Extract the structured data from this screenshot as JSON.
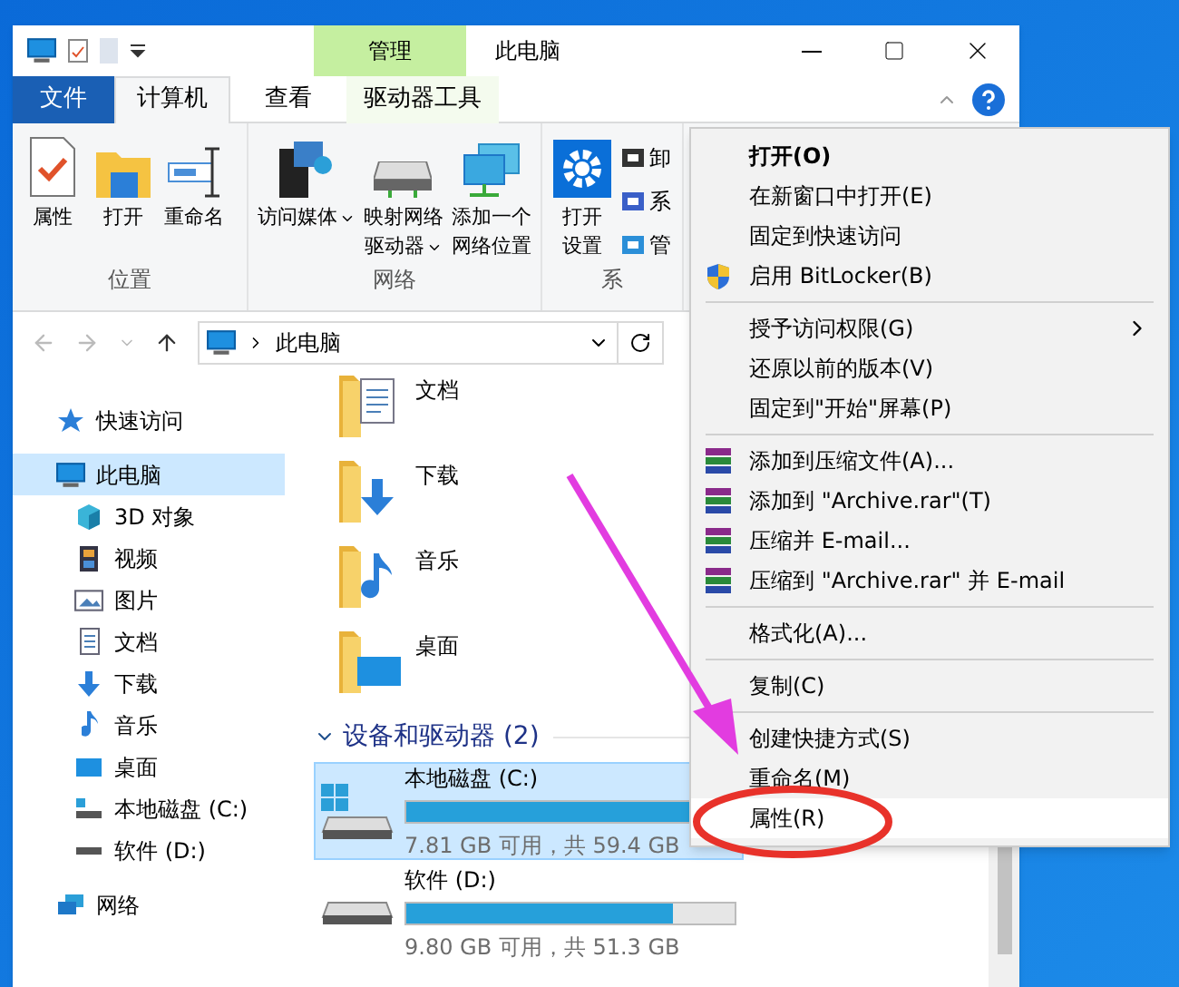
{
  "window": {
    "title": "此电脑",
    "context_header": "管理"
  },
  "ribbon_tabs": [
    {
      "label": "文件",
      "kind": "file",
      "selected": false
    },
    {
      "label": "计算机",
      "kind": "tab",
      "selected": true
    },
    {
      "label": "查看",
      "kind": "tab",
      "selected": false
    },
    {
      "label": "驱动器工具",
      "kind": "context",
      "selected": false
    }
  ],
  "ribbon_groups": [
    {
      "label": "位置",
      "buttons": [
        {
          "lines": [
            "属性"
          ],
          "kind": "properties",
          "dropdown": false
        },
        {
          "lines": [
            "打开"
          ],
          "kind": "open",
          "dropdown": false
        },
        {
          "lines": [
            "重命名"
          ],
          "kind": "rename",
          "dropdown": false
        }
      ]
    },
    {
      "label": "网络",
      "buttons": [
        {
          "lines": [
            "访问媒体"
          ],
          "kind": "media",
          "dropdown": true
        },
        {
          "lines": [
            "映射网络",
            "驱动器"
          ],
          "kind": "drive",
          "dropdown": true
        },
        {
          "lines": [
            "添加一个",
            "网络位置"
          ],
          "kind": "network",
          "dropdown": false
        }
      ]
    },
    {
      "label": "系",
      "buttons": [
        {
          "lines": [
            "打开",
            "设置"
          ],
          "kind": "settings",
          "dropdown": false
        }
      ],
      "small_items": [
        {
          "label": "卸",
          "kind": "uninstall"
        },
        {
          "label": "系",
          "kind": "system"
        },
        {
          "label": "管",
          "kind": "manage"
        }
      ]
    }
  ],
  "address_bar": {
    "path": "此电脑"
  },
  "navigation": [
    {
      "label": "快速访问",
      "kind": "star",
      "selected": false
    },
    {
      "label": "此电脑",
      "kind": "pc",
      "selected": true,
      "children": [
        {
          "label": "3D 对象",
          "kind": "cube",
          "selected": false
        },
        {
          "label": "视频",
          "kind": "video",
          "selected": false
        },
        {
          "label": "图片",
          "kind": "picture",
          "selected": false
        },
        {
          "label": "文档",
          "kind": "doc",
          "selected": false
        },
        {
          "label": "下载",
          "kind": "download",
          "selected": false
        },
        {
          "label": "音乐",
          "kind": "music",
          "selected": false
        },
        {
          "label": "桌面",
          "kind": "desktop",
          "selected": false
        },
        {
          "label": "本地磁盘 (C:)",
          "kind": "sysdisk",
          "selected": false
        },
        {
          "label": "软件 (D:)",
          "kind": "disk",
          "selected": false
        }
      ]
    },
    {
      "label": "网络",
      "kind": "network",
      "selected": false
    }
  ],
  "folders": [
    {
      "name": "文档",
      "kind": "doc"
    },
    {
      "name": "下载",
      "kind": "download"
    },
    {
      "name": "音乐",
      "kind": "music"
    },
    {
      "name": "桌面",
      "kind": "desktop"
    }
  ],
  "devices_section": {
    "title": "设备和驱动器 (2)",
    "expanded": true
  },
  "drives": [
    {
      "name": "本地磁盘 (C:)",
      "system": true,
      "level": 0.87,
      "reading": "7.81 GB 可用，共 59.4 GB",
      "selected": true
    },
    {
      "name": "软件 (D:)",
      "system": false,
      "level": 0.81,
      "reading": "9.80 GB 可用，共 51.3 GB",
      "selected": false
    }
  ],
  "context_menu": [
    {
      "kind": "item",
      "label": "打开(O)",
      "bold": true,
      "submenu": false,
      "selected": false
    },
    {
      "kind": "item",
      "label": "在新窗口中打开(E)",
      "bold": false,
      "submenu": false,
      "selected": false
    },
    {
      "kind": "item",
      "label": "固定到快速访问",
      "bold": false,
      "submenu": false,
      "selected": false
    },
    {
      "kind": "shield_item",
      "label": "启用 BitLocker(B)",
      "bold": false,
      "submenu": false,
      "selected": false
    },
    {
      "kind": "separator"
    },
    {
      "kind": "item",
      "label": "授予访问权限(G)",
      "bold": false,
      "submenu": true,
      "selected": false
    },
    {
      "kind": "item",
      "label": "还原以前的版本(V)",
      "bold": false,
      "submenu": false,
      "selected": false
    },
    {
      "kind": "item",
      "label": "固定到\"开始\"屏幕(P)",
      "bold": false,
      "submenu": false,
      "selected": false
    },
    {
      "kind": "separator"
    },
    {
      "kind": "archive_item",
      "label": "添加到压缩文件(A)...",
      "bold": false,
      "submenu": false,
      "selected": false
    },
    {
      "kind": "archive_item",
      "label": "添加到 \"Archive.rar\"(T)",
      "bold": false,
      "submenu": false,
      "selected": false
    },
    {
      "kind": "archive_item",
      "label": "压缩并 E-mail...",
      "bold": false,
      "submenu": false,
      "selected": false
    },
    {
      "kind": "archive_item",
      "label": "压缩到 \"Archive.rar\" 并 E-mail",
      "bold": false,
      "submenu": false,
      "selected": false
    },
    {
      "kind": "separator"
    },
    {
      "kind": "item",
      "label": "格式化(A)...",
      "bold": false,
      "submenu": false,
      "selected": false
    },
    {
      "kind": "separator"
    },
    {
      "kind": "item",
      "label": "复制(C)",
      "bold": false,
      "submenu": false,
      "selected": false
    },
    {
      "kind": "separator"
    },
    {
      "kind": "item",
      "label": "创建快捷方式(S)",
      "bold": false,
      "submenu": false,
      "selected": false
    },
    {
      "kind": "item",
      "label": "重命名(M)",
      "bold": false,
      "submenu": false,
      "selected": false
    },
    {
      "kind": "item",
      "label": "属性(R)",
      "bold": false,
      "submenu": false,
      "selected": true
    }
  ]
}
